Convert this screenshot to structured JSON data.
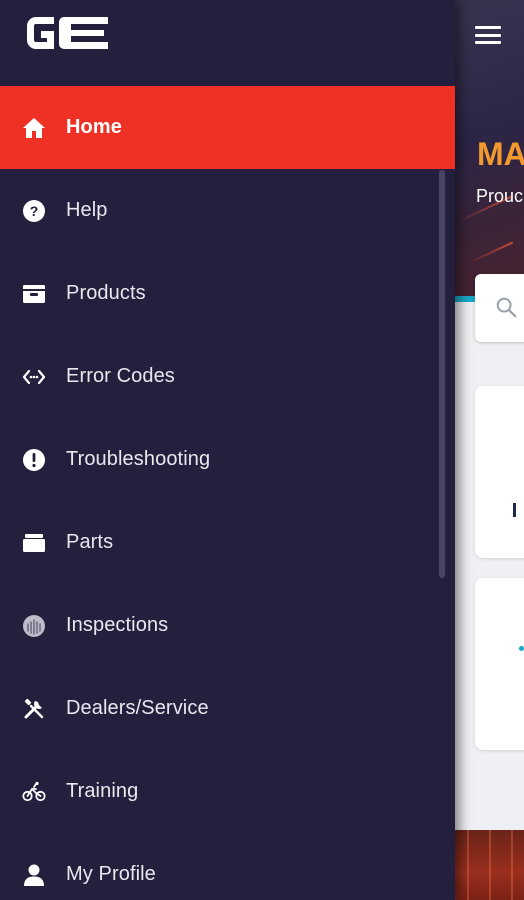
{
  "app": {
    "logo_text": "GE"
  },
  "background_page": {
    "hero_title": "MA",
    "hero_subtitle": "Prouc",
    "hamburger_icon": "hamburger-menu-icon",
    "search_icon": "search-icon",
    "hero_color": "#f29a2e"
  },
  "drawer": {
    "background_color": "#231f3c",
    "active_color": "#ee3124",
    "items": [
      {
        "label": "Home",
        "icon": "home-icon",
        "active": true
      },
      {
        "label": "Help",
        "icon": "help-icon",
        "active": false
      },
      {
        "label": "Products",
        "icon": "products-icon",
        "active": false
      },
      {
        "label": "Error Codes",
        "icon": "code-icon",
        "active": false
      },
      {
        "label": "Troubleshooting",
        "icon": "exclamation-icon",
        "active": false
      },
      {
        "label": "Parts",
        "icon": "parts-icon",
        "active": false
      },
      {
        "label": "Inspections",
        "icon": "inspections-icon",
        "active": false
      },
      {
        "label": "Dealers/Service",
        "icon": "tools-icon",
        "active": false
      },
      {
        "label": "Training",
        "icon": "bicycle-icon",
        "active": false
      },
      {
        "label": "My Profile",
        "icon": "user-icon",
        "active": false
      }
    ]
  }
}
